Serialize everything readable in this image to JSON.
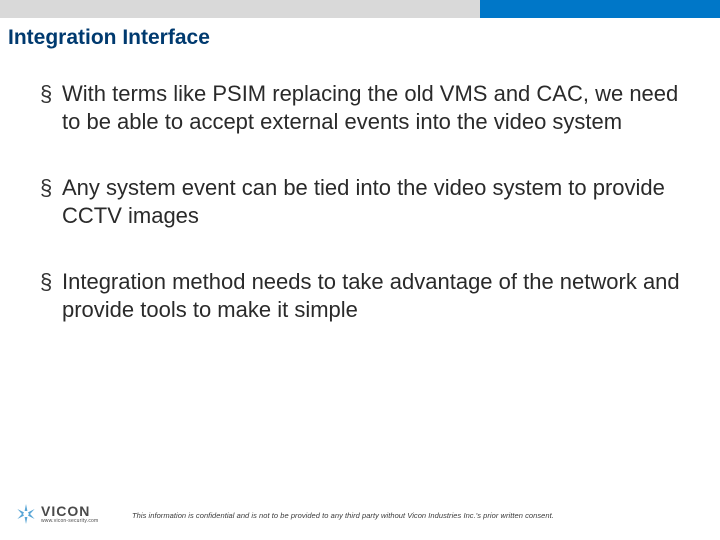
{
  "title": "Integration Interface",
  "bullets": [
    "With terms like PSIM replacing the old VMS and CAC, we need to be able to accept external events into the video system",
    "Any system event can be tied into the video system to provide CCTV images",
    "Integration method needs to take advantage of the network and provide tools to make it simple"
  ],
  "logo": {
    "name": "VICON",
    "url": "www.vicon-security.com"
  },
  "disclaimer": "This information is confidential and is not to be provided to any third party without Vicon Industries Inc.'s  prior written consent."
}
